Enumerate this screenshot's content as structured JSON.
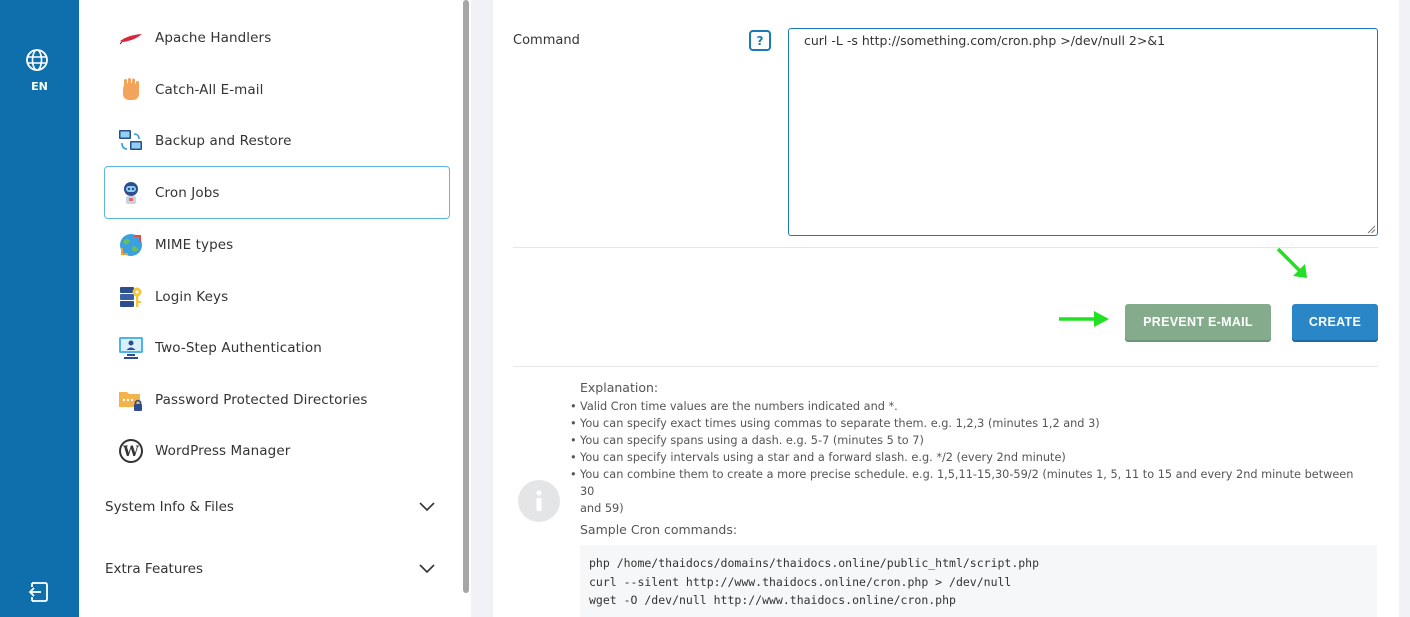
{
  "rail": {
    "language": "EN"
  },
  "sidebar": {
    "items": [
      {
        "label": "Apache Handlers",
        "icon": "feather-icon",
        "active": false
      },
      {
        "label": "Catch-All E-mail",
        "icon": "hand-icon",
        "active": false
      },
      {
        "label": "Backup and Restore",
        "icon": "computers-sync-icon",
        "active": false
      },
      {
        "label": "Cron Jobs",
        "icon": "robot-icon",
        "active": true
      },
      {
        "label": "MIME types",
        "icon": "globe-arrows-icon",
        "active": false
      },
      {
        "label": "Login Keys",
        "icon": "server-key-icon",
        "active": false
      },
      {
        "label": "Two-Step Authentication",
        "icon": "monitor-user-icon",
        "active": false
      },
      {
        "label": "Password Protected Directories",
        "icon": "folder-lock-icon",
        "active": false
      },
      {
        "label": "WordPress Manager",
        "icon": "wordpress-icon",
        "active": false
      }
    ],
    "sections": [
      {
        "label": "System Info & Files"
      },
      {
        "label": "Extra Features"
      }
    ]
  },
  "form": {
    "command_label": "Command",
    "help_label": "?",
    "command_value": "curl -L -s http://something.com/cron.php >/dev/null 2>&1",
    "prevent_email_label": "PREVENT E-MAIL",
    "create_label": "CREATE"
  },
  "explanation": {
    "title": "Explanation:",
    "points": [
      "Valid Cron time values are the numbers indicated and *.",
      "You can specify exact times using commas to separate them. e.g. 1,2,3 (minutes 1,2 and 3)",
      "You can specify spans using a dash. e.g. 5-7 (minutes 5 to 7)",
      "You can specify intervals using a star and a forward slash. e.g. */2 (every 2nd minute)",
      "You can combine them to create a more precise schedule. e.g. 1,5,11-15,30-59/2 (minutes 1, 5, 11 to 15 and every 2nd minute between 30",
      "and 59)"
    ],
    "sample_title": "Sample Cron commands:",
    "samples": [
      "php /home/thaidocs/domains/thaidocs.online/public_html/script.php",
      "curl --silent http://www.thaidocs.online/cron.php > /dev/null",
      "wget -O /dev/null http://www.thaidocs.online/cron.php"
    ]
  },
  "colors": {
    "rail": "#0f6fad",
    "accent": "#1a7ab8",
    "prevent_button": "#84ac8c",
    "create_button": "#2a86c6",
    "arrow": "#22e022"
  }
}
